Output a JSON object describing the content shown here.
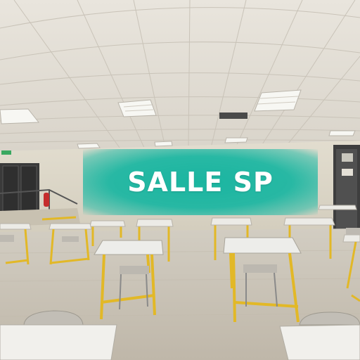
{
  "banner": {
    "title": "SALLE SP",
    "color": "#1fb39e"
  },
  "scene": {
    "description_colors": {
      "ceiling": "#e6e2da",
      "floor": "#cbc4b6",
      "wall": "#dcd6c6",
      "desk_top": "#eeeeea",
      "desk_legs": "#e2b827",
      "chair": "#bcb8b0",
      "door": "#3a3a3a"
    },
    "icons": [
      "fire-extinguisher-icon",
      "exit-sign-icon"
    ]
  }
}
